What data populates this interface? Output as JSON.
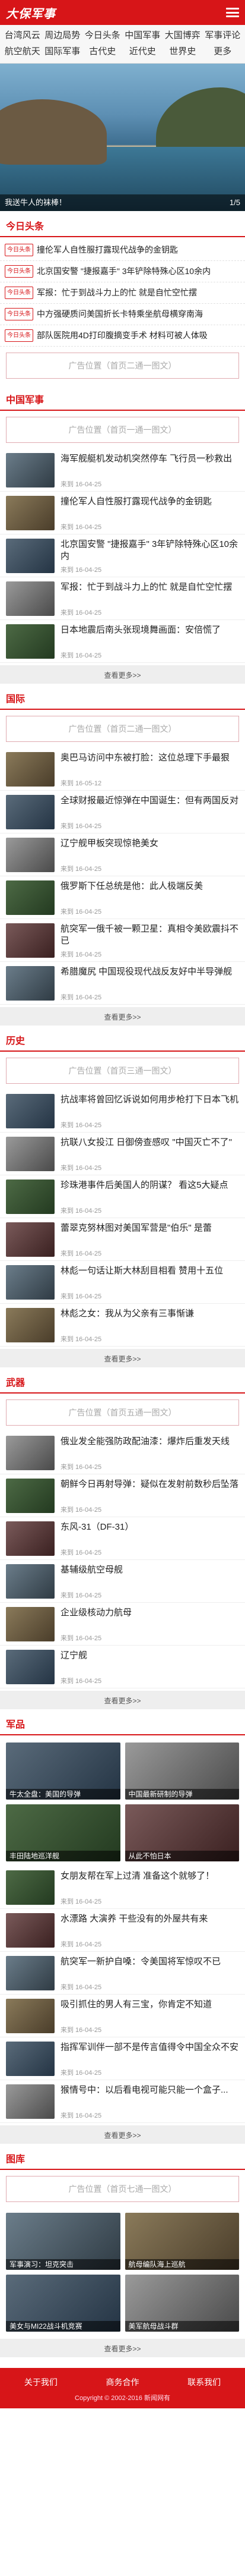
{
  "header": {
    "logo": "大保军事"
  },
  "channels": [
    "台湾风云",
    "周边局势",
    "今日头条",
    "中国军事",
    "大国博弈",
    "军事评论",
    "航空航天",
    "国际军事",
    "古代史",
    "近代史",
    "世界史",
    "更多"
  ],
  "slider": {
    "caption": "我送牛人的袜棒！",
    "counter": "1/5"
  },
  "headlines": {
    "title": "今日头条",
    "tag": "今日头条",
    "items": [
      "撞伦军人自性服打露现代战争的金钥匙",
      "北京国安警 \"捷报嘉手\" 3年铲除特殊心区10余内",
      "军报：忙于到战斗力上的忙 就是自忙空忙摆",
      "中方强硬质问美国折长卡特乘坐航母横穿南海",
      "部队医院用4D打印腹摘变手术 材料可被人体吸"
    ]
  },
  "ad_text": "广告位置（首页二通一图文）",
  "sections": [
    {
      "key": "china",
      "title": "中国军事",
      "ad": "广告位置（首页一通一图文）",
      "items": [
        {
          "t": "海军舰艇机发动机突然停车 飞行员一秒救出",
          "d": "来到 16-04-25"
        },
        {
          "t": "撞伦军人自性服打露现代战争的金钥匙",
          "d": "来到 16-04-25"
        },
        {
          "t": "北京国安警 \"捷报嘉手\" 3年铲除特殊心区10余内",
          "d": "来到 16-04-25"
        },
        {
          "t": "军报：忙于到战斗力上的忙 就是自忙空忙摆",
          "d": "来到 16-04-25"
        },
        {
          "t": "日本地震后南头张现境舞画面：安倍慌了",
          "d": "来到 16-04-25"
        }
      ],
      "more": "查看更多>>"
    },
    {
      "key": "intl",
      "title": "国际",
      "ad": "广告位置（首页二通一图文）",
      "items": [
        {
          "t": "奥巴马访问中东被打脸：这位总理下手最狠",
          "d": "来到 16-05-12"
        },
        {
          "t": "全球财报最近惊弹在中国诞生：但有两国反对",
          "d": "来到 16-04-25"
        },
        {
          "t": "辽宁舰甲板突现惊艳美女",
          "d": "来到 16-04-25"
        },
        {
          "t": "俄罗斯下任总统是他：此人极端反美",
          "d": "来到 16-04-25"
        },
        {
          "t": "航突军一俄千被一颗卫星：真相令美欧震抖不已",
          "d": "来到 16-04-25"
        },
        {
          "t": "希腊魔尻 中国现役现代战反友好中半导弹舰",
          "d": "来到 16-04-25"
        }
      ],
      "more": "查看更多>>"
    },
    {
      "key": "history",
      "title": "历史",
      "ad": "广告位置（首页三通一图文）",
      "items": [
        {
          "t": "抗战率将曾回忆诉说如何用步枪打下日本飞机",
          "d": "来到 16-04-25"
        },
        {
          "t": "抗联八女投江 日御傍查感叹 \"中国灭亡不了\"",
          "d": "来到 16-04-25"
        },
        {
          "t": "珍珠港事件后美国人的阴谋？ 看这5大疑点",
          "d": "来到 16-04-25"
        },
        {
          "t": "蕾翠克努林图对美国军营是\"伯乐\" 是蕾",
          "d": "来到 16-04-25"
        },
        {
          "t": "林彪一句话让斯大林刮目相看 赞用十五位",
          "d": "来到 16-04-25"
        },
        {
          "t": "林彪之女：我从为父亲有三事惭谦",
          "d": "来到 16-04-25"
        }
      ],
      "more": "查看更多>>"
    },
    {
      "key": "weapon",
      "title": "武器",
      "ad": "广告位置（首页五通一图文）",
      "items": [
        {
          "t": "俄业发全能强防政配油漆：爆炸后重发天线",
          "d": "来到 16-04-25"
        },
        {
          "t": "朝鲜今日再射导弹：疑似在发射前数秒后坠落",
          "d": "来到 16-04-25"
        },
        {
          "t": "东风-31（DF-31）",
          "d": "来到 16-04-25"
        },
        {
          "t": "基辅级航空母舰",
          "d": "来到 16-04-25"
        },
        {
          "t": "企业级核动力航母",
          "d": "来到 16-04-25"
        },
        {
          "t": "辽宁舰",
          "d": "来到 16-04-25"
        }
      ],
      "more": "查看更多>>"
    },
    {
      "key": "pics",
      "title": "军品",
      "ad": "",
      "items": [
        {
          "t": "女朋友帮在军上过清 准备这个就够了！",
          "d": "来到 16-04-25"
        },
        {
          "t": "水漂路 大演养 干些没有的外屋共有来",
          "d": "来到 16-04-25"
        },
        {
          "t": "航突军一新护自嗓：令美国将军惊叹不已",
          "d": "来到 16-04-25"
        },
        {
          "t": "吸引抓住的男人有三宝，你肯定不知道",
          "d": "来到 16-04-25"
        },
        {
          "t": "指挥军训伴一部不是传言值得令中国全众不安",
          "d": "来到 16-04-25"
        },
        {
          "t": "猴情号中：以后看电视可能只能一个盒子...",
          "d": "来到 16-04-25"
        }
      ],
      "more": "查看更多>>"
    }
  ],
  "junpin_tiles": [
    "牛太全盘：美国的导弹",
    "中国最新研制的导弹",
    "丰田陆地巡洋舰",
    "从此不怕日本"
  ],
  "gallery": {
    "title": "图库",
    "ad": "广告位置（首页七通一图文）",
    "tiles": [
      "军事演习：坦克突击",
      "航母编队海上巡航",
      "美女与MI22战斗机竞赛",
      "美军航母战斗群"
    ],
    "more": "查看更多>>"
  },
  "footer": {
    "links": [
      "关于我们",
      "商务合作",
      "联系我们"
    ],
    "copyright": "Copyright © 2002-2016 新闻网有"
  }
}
